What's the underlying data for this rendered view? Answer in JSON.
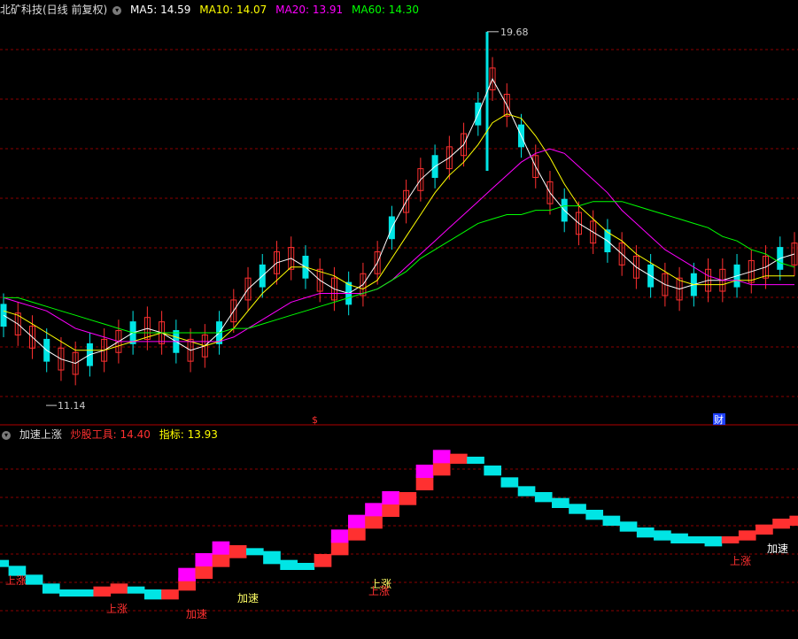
{
  "main_panel": {
    "title": "北矿科技(日线 前复权)",
    "ma_labels": [
      {
        "text": "MA5: 14.59",
        "color": "#ffffff"
      },
      {
        "text": "MA10: 14.07",
        "color": "#ffff00"
      },
      {
        "text": "MA20: 13.91",
        "color": "#ff00ff"
      },
      {
        "text": "MA60: 14.30",
        "color": "#00ff00"
      }
    ],
    "high_label": "19.68",
    "low_label": "11.14",
    "markers": [
      {
        "text": "$",
        "color": "#ff3030"
      },
      {
        "text": "财",
        "color": "#ffffff",
        "bg": "#1e40ff"
      }
    ]
  },
  "sub_panel": {
    "title": "加速上涨",
    "labels": [
      {
        "text": "炒股工具: 14.40",
        "color": "#ff3030"
      },
      {
        "text": "指标: 13.93",
        "color": "#ffff00"
      }
    ],
    "annotations": [
      "上涨",
      "上涨",
      "加速",
      "加速",
      "上涨",
      "上涨",
      "上涨",
      "加速"
    ]
  },
  "colors": {
    "up": "#ff3030",
    "down": "#00e5e5",
    "grid": "#8b0000",
    "accel": "#ff00ff"
  },
  "chart_data": [
    {
      "type": "candlestick",
      "series": [
        {
          "name": "MA5",
          "values": [
            13.2,
            13.0,
            12.7,
            12.4,
            12.2,
            12.1,
            12.3,
            12.4,
            12.6,
            12.8,
            12.9,
            12.8,
            12.6,
            12.4,
            12.5,
            12.8,
            13.3,
            13.8,
            14.1,
            14.4,
            14.5,
            14.3,
            14.0,
            13.8,
            13.7,
            13.9,
            14.4,
            15.2,
            15.8,
            16.3,
            16.6,
            16.8,
            17.1,
            17.8,
            18.6,
            18.0,
            17.3,
            16.6,
            16.0,
            15.6,
            15.3,
            15.1,
            14.9,
            14.6,
            14.3,
            14.1,
            13.9,
            13.8,
            13.9,
            14.0,
            14.0,
            14.1,
            14.2,
            14.3,
            14.5,
            14.6
          ]
        },
        {
          "name": "MA10",
          "values": [
            13.3,
            13.2,
            13.0,
            12.8,
            12.6,
            12.4,
            12.4,
            12.4,
            12.5,
            12.6,
            12.7,
            12.8,
            12.7,
            12.6,
            12.5,
            12.6,
            12.9,
            13.3,
            13.7,
            14.0,
            14.3,
            14.3,
            14.2,
            14.1,
            13.9,
            13.8,
            14.0,
            14.5,
            15.0,
            15.5,
            16.0,
            16.4,
            16.7,
            17.1,
            17.6,
            17.8,
            17.7,
            17.3,
            16.8,
            16.2,
            15.7,
            15.4,
            15.1,
            14.9,
            14.6,
            14.4,
            14.2,
            14.0,
            13.9,
            13.9,
            13.9,
            14.0,
            14.0,
            14.1,
            14.1,
            14.1
          ]
        },
        {
          "name": "MA20",
          "values": [
            13.6,
            13.5,
            13.4,
            13.3,
            13.1,
            12.9,
            12.8,
            12.7,
            12.6,
            12.6,
            12.6,
            12.6,
            12.6,
            12.6,
            12.6,
            12.6,
            12.7,
            12.9,
            13.1,
            13.3,
            13.5,
            13.6,
            13.7,
            13.7,
            13.7,
            13.7,
            13.8,
            14.0,
            14.3,
            14.6,
            14.9,
            15.2,
            15.5,
            15.8,
            16.1,
            16.4,
            16.7,
            16.9,
            17.0,
            16.9,
            16.6,
            16.3,
            16.0,
            15.6,
            15.3,
            15.0,
            14.7,
            14.5,
            14.3,
            14.1,
            14.0,
            14.0,
            13.9,
            13.9,
            13.9,
            13.9
          ]
        },
        {
          "name": "MA60",
          "values": [
            13.6,
            13.6,
            13.5,
            13.4,
            13.3,
            13.2,
            13.1,
            13.0,
            12.9,
            12.8,
            12.8,
            12.8,
            12.8,
            12.8,
            12.8,
            12.8,
            12.9,
            12.9,
            13.0,
            13.1,
            13.2,
            13.3,
            13.4,
            13.5,
            13.6,
            13.7,
            13.8,
            14.0,
            14.2,
            14.5,
            14.7,
            14.9,
            15.1,
            15.3,
            15.4,
            15.5,
            15.5,
            15.6,
            15.6,
            15.7,
            15.7,
            15.8,
            15.8,
            15.8,
            15.7,
            15.6,
            15.5,
            15.4,
            15.3,
            15.2,
            15.0,
            14.9,
            14.7,
            14.6,
            14.4,
            14.3
          ]
        }
      ],
      "ylim": [
        11.0,
        20.0
      ],
      "high": 19.68,
      "low": 11.14
    },
    {
      "type": "area",
      "series": [
        {
          "name": "炒股工具",
          "values": [
            1.9,
            1.6,
            1.3,
            1.0,
            0.9,
            0.9,
            1.0,
            1.1,
            1.0,
            0.8,
            0.9,
            1.3,
            1.8,
            2.2,
            2.4,
            2.3,
            2.0,
            1.8,
            1.8,
            2.1,
            2.6,
            3.1,
            3.5,
            3.9,
            4.2,
            4.8,
            5.3,
            5.5,
            5.4,
            5.0,
            4.6,
            4.3,
            4.1,
            3.9,
            3.7,
            3.5,
            3.3,
            3.1,
            2.9,
            2.8,
            2.7,
            2.7,
            2.6,
            2.7,
            2.9,
            3.1,
            3.3,
            3.4
          ]
        },
        {
          "name": "指标",
          "values": [
            1.9,
            1.7,
            1.4,
            1.1,
            0.9,
            0.9,
            0.9,
            1.0,
            1.0,
            0.9,
            0.8,
            1.1,
            1.5,
            1.9,
            2.2,
            2.3,
            2.2,
            1.9,
            1.8,
            1.9,
            2.3,
            2.8,
            3.2,
            3.6,
            4.0,
            4.5,
            5.0,
            5.4,
            5.4,
            5.1,
            4.7,
            4.4,
            4.2,
            4.0,
            3.8,
            3.6,
            3.4,
            3.2,
            3.0,
            2.9,
            2.8,
            2.7,
            2.7,
            2.7,
            2.8,
            3.0,
            3.2,
            3.3
          ]
        }
      ],
      "ylim": [
        0,
        6
      ]
    }
  ]
}
